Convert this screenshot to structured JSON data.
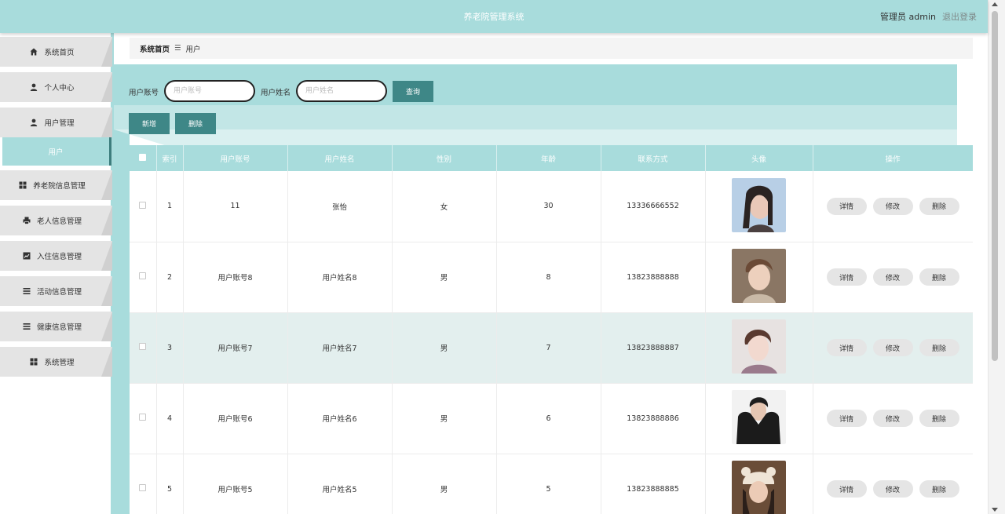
{
  "header": {
    "title": "养老院管理系统",
    "user": "管理员 admin",
    "logout": "退出登录"
  },
  "sidebar": {
    "items": [
      {
        "label": "系统首页",
        "icon": "home-icon"
      },
      {
        "label": "个人中心",
        "icon": "user-icon"
      },
      {
        "label": "用户管理",
        "icon": "user-icon"
      },
      {
        "label": "养老院信息管理",
        "icon": "grid-icon"
      },
      {
        "label": "老人信息管理",
        "icon": "print-icon"
      },
      {
        "label": "入住信息管理",
        "icon": "chart-icon"
      },
      {
        "label": "活动信息管理",
        "icon": "list-icon"
      },
      {
        "label": "健康信息管理",
        "icon": "list-icon"
      },
      {
        "label": "系统管理",
        "icon": "grid-icon"
      }
    ],
    "sub_item": "用户"
  },
  "breadcrumb": {
    "home": "系统首页",
    "separator": "☰",
    "current": "用户"
  },
  "search": {
    "account_label": "用户账号",
    "account_placeholder": "用户账号",
    "name_label": "用户姓名",
    "name_placeholder": "用户姓名",
    "query_button": "查询"
  },
  "actions": {
    "add": "新增",
    "delete": "删除"
  },
  "table": {
    "headers": [
      "索引",
      "用户账号",
      "用户姓名",
      "性别",
      "年龄",
      "联系方式",
      "头像",
      "操作"
    ],
    "ops": [
      "详情",
      "修改",
      "删除"
    ],
    "rows": [
      {
        "index": "1",
        "account": "11",
        "name": "张怡",
        "gender": "女",
        "age": "30",
        "phone": "13336666552",
        "avatar": "avatar-photo-woman"
      },
      {
        "index": "2",
        "account": "用户账号8",
        "name": "用户姓名8",
        "gender": "男",
        "age": "8",
        "phone": "13823888888",
        "avatar": "avatar-photo-man"
      },
      {
        "index": "3",
        "account": "用户账号7",
        "name": "用户姓名7",
        "gender": "男",
        "age": "7",
        "phone": "13823888887",
        "avatar": "avatar-photo-man"
      },
      {
        "index": "4",
        "account": "用户账号6",
        "name": "用户姓名6",
        "gender": "男",
        "age": "6",
        "phone": "13823888886",
        "avatar": "avatar-photo-man"
      },
      {
        "index": "5",
        "account": "用户账号5",
        "name": "用户姓名5",
        "gender": "男",
        "age": "5",
        "phone": "13823888885",
        "avatar": "avatar-photo-woman"
      }
    ]
  },
  "colors": {
    "accent": "#a8dcdc",
    "button": "#3e8787"
  }
}
